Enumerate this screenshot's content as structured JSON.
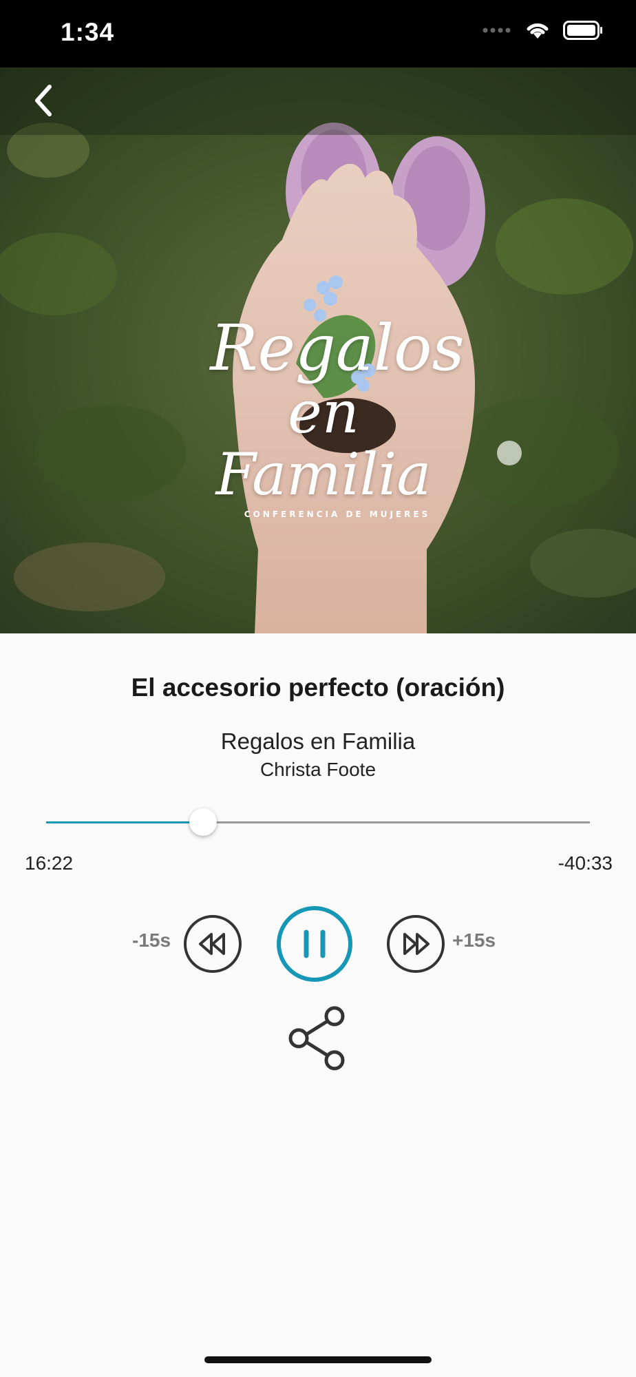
{
  "status_bar": {
    "time": "1:34"
  },
  "nav": {
    "back_icon": "chevron-left-icon"
  },
  "hero": {
    "logo_line1": "Regalos",
    "logo_line2": "en Familia",
    "logo_sub": "CONFERENCIA DE MUJERES"
  },
  "track": {
    "title": "El accesorio perfecto (oración)",
    "album": "Regalos en Familia",
    "artist": "Christa Foote"
  },
  "progress": {
    "elapsed": "16:22",
    "remaining": "-40:33",
    "fraction": 0.288
  },
  "controls": {
    "skip_back_label": "-15s",
    "skip_forward_label": "+15s",
    "state": "playing"
  },
  "colors": {
    "accent": "#1797b6",
    "control_stroke": "#333333",
    "track_bg": "#9a9a9a"
  }
}
